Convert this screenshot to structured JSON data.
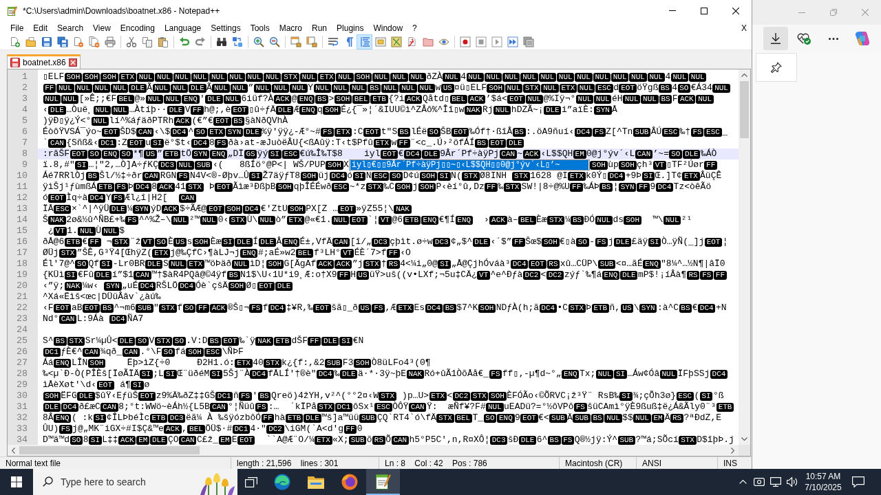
{
  "window": {
    "title": "*C:\\Users\\admin\\Downloads\\boatnet.x86 - Notepad++"
  },
  "menu": {
    "items": [
      "File",
      "Edit",
      "Search",
      "View",
      "Encoding",
      "Language",
      "Settings",
      "Tools",
      "Macro",
      "Run",
      "Plugins",
      "Window",
      "?"
    ],
    "close_document": "X"
  },
  "toolbar": {
    "toggles": [
      {
        "on": false
      },
      {
        "on": false
      },
      {
        "on": true
      }
    ]
  },
  "tabs": [
    {
      "label": "boatnet.x86",
      "selected": true,
      "modified": true
    }
  ],
  "editor": {
    "lines": [
      {
        "number": "1",
        "current": false,
        "runs": [
          "▯ELF",
          {
            "ctrl": "SOH"
          },
          {
            "ctrl": "SOH"
          },
          {
            "ctrl": "SOH"
          },
          {
            "ctrl": "ETX"
          },
          {
            "ctrl": "NUL"
          },
          {
            "ctrl": "NUL"
          },
          {
            "ctrl": "NUL"
          },
          {
            "ctrl": "NUL"
          },
          {
            "ctrl": "NUL"
          },
          {
            "ctrl": "NUL"
          },
          {
            "ctrl": "NUL"
          },
          {
            "ctrl": "NUL"
          },
          {
            "ctrl": "STX"
          },
          {
            "ctrl": "NUL"
          },
          {
            "ctrl": "ETX"
          },
          {
            "ctrl": "NUL"
          },
          {
            "ctrl": "SOH"
          },
          {
            "ctrl": "NUL"
          },
          {
            "ctrl": "NUL"
          },
          {
            "ctrl": "NUL"
          },
          "ðZÀ",
          {
            "ctrl": "NUL"
          },
          "4",
          {
            "ctrl": "NUL"
          },
          {
            "ctrl": "NUL"
          },
          {
            "ctrl": "NUL"
          },
          {
            "ctrl": "NUL"
          },
          {
            "ctrl": "NUL"
          },
          {
            "ctrl": "NUL"
          },
          {
            "ctrl": "NUL"
          },
          {
            "ctrl": "NUL"
          },
          {
            "ctrl": "NUL"
          },
          {
            "ctrl": "NUL"
          },
          {
            "ctrl": "NUL"
          },
          "4",
          {
            "ctrl": "NUL"
          },
          {
            "ctrl": "NUL"
          }
        ]
      },
      {
        "number": "2",
        "current": false,
        "runs": [
          {
            "ctrl": "FF"
          },
          {
            "ctrl": "NUL"
          },
          {
            "ctrl": "NUL"
          },
          {
            "ctrl": "NUL"
          },
          {
            "ctrl": "NUL"
          },
          {
            "ctrl": "DLE"
          },
          "Ã",
          {
            "ctrl": "NUL"
          },
          {
            "ctrl": "NUL"
          },
          {
            "ctrl": "DLE"
          },
          "Ã",
          {
            "ctrl": "NUL"
          },
          {
            "ctrl": "NUL"
          },
          "”",
          {
            "ctrl": "NUL"
          },
          {
            "ctrl": "NUL"
          },
          {
            "ctrl": "NUL"
          },
          "Y",
          {
            "ctrl": "NUL"
          },
          {
            "ctrl": "NUL"
          },
          {
            "ctrl": "NUL"
          },
          {
            "ctrl": "BS"
          },
          {
            "ctrl": "NUL"
          },
          {
            "ctrl": "NUL"
          },
          {
            "ctrl": "NUL"
          },
          "w",
          {
            "ctrl": "US"
          },
          "¤ü▯ELF",
          {
            "ctrl": "SOH"
          },
          {
            "ctrl": "NUL"
          },
          {
            "ctrl": "STX"
          },
          {
            "ctrl": "NUL"
          },
          {
            "ctrl": "ETX"
          },
          {
            "ctrl": "NUL"
          },
          {
            "ctrl": "ESC"
          },
          "d",
          {
            "ctrl": "EOT"
          },
          "öŸgß",
          {
            "ctrl": "BS"
          },
          "4",
          {
            "ctrl": "SO"
          },
          "€Á34",
          {
            "ctrl": "NUL"
          }
        ]
      },
      {
        "number": "3",
        "current": false,
        "runs": [
          {
            "ctrl": "NUL"
          },
          {
            "ctrl": "NUL"
          },
          "[»Ê;;€F",
          {
            "ctrl": "BEL"
          },
          "@»",
          {
            "ctrl": "NUL"
          },
          {
            "ctrl": "NUL"
          },
          {
            "ctrl": "ENQ"
          },
          "'",
          {
            "ctrl": "DLE"
          },
          {
            "ctrl": "NUL"
          },
          "6iüf?À",
          {
            "ctrl": "ACK"
          },
          "@",
          {
            "ctrl": "ENQ"
          },
          {
            "ctrl": "BS"
          },
          ">",
          {
            "ctrl": "SOH"
          },
          {
            "ctrl": "BEL"
          },
          {
            "ctrl": "ETB"
          },
          "{?i",
          {
            "ctrl": "ACK"
          },
          "Qåtd▯",
          {
            "ctrl": "BEL"
          },
          {
            "ctrl": "ACK"
          },
          "’$á<",
          {
            "ctrl": "EOT"
          },
          {
            "ctrl": "NUL"
          },
          "@%Iÿ¬°",
          {
            "ctrl": "NUL"
          },
          {
            "ctrl": "NUL"
          },
          "éH",
          {
            "ctrl": "NUL"
          },
          {
            "ctrl": "NUL"
          },
          {
            "ctrl": "BS"
          },
          "F",
          {
            "ctrl": "ACK"
          },
          {
            "ctrl": "NUL"
          }
        ]
      },
      {
        "number": "4",
        "current": false,
        "runs": [
          "‹",
          {
            "ctrl": "DLE"
          },
          "…Òuë¸",
          {
            "ctrl": "NUL"
          },
          {
            "ctrl": "NUL"
          },
          "…Àtíþ··",
          {
            "ctrl": "DLE"
          },
          "V",
          {
            "ctrl": "FF"
          },
          "h@;,è",
          {
            "ctrl": "EOT"
          },
          "▯û÷ƒÄ",
          {
            "ctrl": "DLE"
          },
          "Æ",
          {
            "ctrl": "ENQ"
          },
          "q",
          {
            "ctrl": "SOH"
          },
          "É¿{¯»¦´&IUU©ì^ZÂô%^Îî▯w",
          {
            "ctrl": "NAK"
          },
          "Rj",
          {
            "ctrl": "NUL"
          },
          "hDZÃ~¡",
          {
            "ctrl": "DLE"
          },
          "i”aïÈ:",
          {
            "ctrl": "SYN"
          },
          "Å"
        ]
      },
      {
        "number": "5",
        "current": false,
        "runs": [
          ")ÿÐ▯ÿ¿Ý<°",
          {
            "ctrl": "NUL"
          },
          "lí^%áƒäðPTRh",
          {
            "ctrl": "ACK"
          },
          "(€”€",
          {
            "ctrl": "EOT"
          },
          {
            "ctrl": "BS"
          },
          "§àNðQVhÀ"
        ]
      },
      {
        "number": "6",
        "current": false,
        "runs": [
          "ÉòôŸVSÁ¯ýo~",
          {
            "ctrl": "EOT"
          },
          "ŠD$",
          {
            "ctrl": "CAN"
          },
          "‹\\$",
          {
            "ctrl": "DC4"
          },
          "^",
          {
            "ctrl": "SO"
          },
          {
            "ctrl": "ETX"
          },
          {
            "ctrl": "SYN"
          },
          {
            "ctrl": "DLE"
          },
          "%ÿ'ÿÿ¿-Æ°~#",
          {
            "ctrl": "FS"
          },
          {
            "ctrl": "ETX"
          },
          ":C",
          {
            "ctrl": "EOT"
          },
          "t\"S",
          {
            "ctrl": "BS"
          },
          "lÉë",
          {
            "ctrl": "SO"
          },
          "ŠB",
          {
            "ctrl": "EOT"
          },
          "‰Óf†·ßîÂ",
          {
            "ctrl": "BS"
          },
          ":.öA9ñuí‹",
          {
            "ctrl": "DC4"
          },
          {
            "ctrl": "FS"
          },
          "Z[^Tn",
          {
            "ctrl": "SUB"
          },
          "ÂÚ",
          {
            "ctrl": "ESC"
          },
          "‰†",
          {
            "ctrl": "FS"
          },
          {
            "ctrl": "ESC"
          },
          "_"
        ]
      },
      {
        "number": "7",
        "current": false,
        "runs": [
          "`",
          {
            "ctrl": "CAN"
          },
          "{Sñß&‹",
          {
            "ctrl": "DC1"
          },
          ":Z",
          {
            "ctrl": "EOT"
          },
          "u",
          {
            "ctrl": "SI"
          },
          "ë°$t‹",
          {
            "ctrl": "DC4"
          },
          "8",
          {
            "ctrl": "FS"
          },
          "ðà›at-æJuòëÂU{<ßAûÿ:T‹t$Pfû",
          {
            "ctrl": "ETX"
          },
          "w",
          {
            "ctrl": "FF"
          },
          "¨<c_.Ú›²öfÁÍ",
          {
            "ctrl": "BS"
          },
          {
            "ctrl": "EOT"
          },
          {
            "ctrl": "DLE"
          }
        ]
      },
      {
        "number": "8",
        "current": true,
        "runs": [
          ":râŠF",
          {
            "ctrl": "EOT"
          },
          {
            "ctrl": "SO"
          },
          {
            "ctrl": "ENQ"
          },
          {
            "ctrl": "SO"
          },
          "*¶",
          {
            "ctrl": "US"
          },
          "”",
          {
            "ctrl": "ETB"
          },
          "tÖ",
          {
            "ctrl": "SYN"
          },
          {
            "ctrl": "ENQ"
          },
          "„DÏ",
          {
            "ctrl": "GS"
          },
          "ÿý",
          {
            "ctrl": "SI"
          },
          {
            "ctrl": "ESC"
          },
          "€ú‰Î‰T$8    iyl",
          {
            "ctrl": "EOT"
          },
          "€",
          {
            "ctrl": "DC4"
          },
          {
            "ctrl": "DLE"
          },
          "9Âr´Pf÷àÿPj",
          {
            "ctrl": "CAN"
          },
          "~",
          {
            "ctrl": "ACK"
          },
          "‹L$$QH",
          {
            "ctrl": "EM"
          },
          "0@j°ýv´‹L",
          {
            "ctrl": "CAN"
          },
          "’~=",
          {
            "ctrl": "SO"
          },
          {
            "ctrl": "DLE"
          },
          "‰ÁÒ"
        ]
      },
      {
        "number": "9",
        "current": false,
        "runs": [
          "ï.8,#\"",
          {
            "ctrl": "SI"
          },
          "…¦\"2,…Ò]A÷ƒKÇ",
          {
            "ctrl": "DC3"
          },
          {
            "ctrl": "NUL"
          },
          {
            "ctrl": "SUB"
          },
          "‹(   8ßÍö°@P<| WŠ/PUP",
          {
            "ctrl": "SOH"
          },
          "X"
        ],
        "autocomplete": {
          "items": [
            {
              "text": "iyl▯€▯▯9Âr´Pf÷àÿPj▯▯~▯‹L$$QH▯▯0@j°ýv´‹L▯’~",
              "selected": true
            }
          ]
        },
        "runs_after": [
          {
            "ctrl": "SOH"
          },
          "ùp",
          {
            "ctrl": "SOH"
          },
          "çh³",
          {
            "ctrl": "VT"
          },
          "▯TF²Úør",
          {
            "ctrl": "FF"
          }
        ]
      },
      {
        "number": "10",
        "current": false,
        "runs": [
          "Áé7RRlÒj",
          {
            "ctrl": "BS"
          },
          "Šl/½‡÷ðr",
          {
            "ctrl": "CAN"
          },
          "RGN",
          {
            "ctrl": "FS"
          },
          "N4V<®-Øþv…Û",
          {
            "ctrl": "SI"
          },
          "Ž7äÿƒT8",
          {
            "ctrl": "SOH"
          },
          "üj",
          {
            "ctrl": "DC4"
          },
          "ó",
          {
            "ctrl": "SI"
          },
          "N",
          {
            "ctrl": "ESC"
          },
          {
            "ctrl": "SO"
          },
          "D¢ú",
          {
            "ctrl": "SOH"
          },
          {
            "ctrl": "SI"
          },
          "N(",
          {
            "ctrl": "STX"
          },
          "Ø8INH ",
          {
            "ctrl": "STX"
          },
          "1628 @I",
          {
            "ctrl": "ETX"
          },
          "k0Ý▯",
          {
            "ctrl": "DC4"
          },
          "+9Þ",
          {
            "ctrl": "SI"
          },
          "Œ.]T¢",
          {
            "ctrl": "ETX"
          },
          "ÂüÇÊ"
        ]
      },
      {
        "number": "11",
        "current": false,
        "runs": [
          "ÿìŠj¹ƒùmßÁ",
          {
            "ctrl": "ETB"
          },
          {
            "ctrl": "FS"
          },
          "Þ",
          {
            "ctrl": "DC4"
          },
          "8",
          {
            "ctrl": "ACK"
          },
          "41",
          {
            "ctrl": "STX"
          },
          " Þ",
          {
            "ctrl": "EOT"
          },
          "Ãìæ³ÐßþB",
          {
            "ctrl": "SOH"
          },
          "qþÎÉÉwð",
          {
            "ctrl": "ESC"
          },
          "~*z",
          {
            "ctrl": "STX"
          },
          "‰C",
          {
            "ctrl": "SOH"
          },
          "j",
          {
            "ctrl": "SOH"
          },
          "P‹èí°û,Dz",
          {
            "ctrl": "FF"
          },
          "‰",
          {
            "ctrl": "STX"
          },
          "SW!|8÷@%U",
          {
            "ctrl": "FF"
          },
          "‰ÁÞ",
          {
            "ctrl": "BS"
          },
          "¦",
          {
            "ctrl": "SYN"
          },
          {
            "ctrl": "FF"
          },
          "9",
          {
            "ctrl": "DC4"
          },
          "Tz<òêÃö"
        ]
      },
      {
        "number": "12",
        "current": false,
        "runs": [
          "ó",
          {
            "ctrl": "EOT"
          },
          "Ìq÷à",
          {
            "ctrl": "DC4"
          },
          "Y",
          {
            "ctrl": "FS"
          },
          "Æl¿î|H2[  ",
          {
            "ctrl": "CAN"
          }
        ]
      },
      {
        "number": "13",
        "current": false,
        "runs": [
          "ÏÅ",
          {
            "ctrl": "ESC"
          },
          "×`^|^ÿÜ",
          {
            "ctrl": "DLE"
          },
          "¼",
          {
            "ctrl": "SYN"
          },
          "ýD",
          {
            "ctrl": "ACK"
          },
          "$÷ÃÆ@",
          {
            "ctrl": "EOT"
          },
          {
            "ctrl": "SOH"
          },
          {
            "ctrl": "DC4"
          },
          "€'ZtU",
          {
            "ctrl": "SOH"
          },
          "PX[Z …",
          {
            "ctrl": "EOT"
          },
          "»ÿZ55¦\\",
          {
            "ctrl": "NAK"
          }
        ]
      },
      {
        "number": "14",
        "current": false,
        "runs": [
          "Š",
          {
            "ctrl": "NAK"
          },
          "2ø&½û^ÑB£+‰",
          {
            "ctrl": "FS"
          },
          "^^%Ž–\\",
          {
            "ctrl": "NUL"
          },
          "²™",
          {
            "ctrl": "NUL"
          },
          "0‹",
          {
            "ctrl": "STX"
          },
          "Ù\\",
          {
            "ctrl": "NUL"
          },
          "ò”",
          {
            "ctrl": "ETX"
          },
          "@«€1.",
          {
            "ctrl": "NUL"
          },
          {
            "ctrl": "EOT"
          },
          "`¦",
          {
            "ctrl": "VT"
          },
          "@6",
          {
            "ctrl": "ETB"
          },
          {
            "ctrl": "ENQ"
          },
          "€¶Í",
          {
            "ctrl": "ENQ"
          },
          "  ›",
          {
            "ctrl": "ACK"
          },
          "à–",
          {
            "ctrl": "BEL"
          },
          "Èæ",
          {
            "ctrl": "STX"
          },
          "¼",
          {
            "ctrl": "BS"
          },
          "ÐÓ",
          {
            "ctrl": "NUL"
          },
          "ds",
          {
            "ctrl": "SOH"
          },
          "  ™\\",
          {
            "ctrl": "NUL"
          },
          "²¹"
        ]
      },
      {
        "number": "15",
        "current": false,
        "runs": [
          " ¿",
          {
            "ctrl": "VT"
          },
          "1.",
          {
            "ctrl": "NUL"
          },
          "Ù",
          {
            "ctrl": "NUL"
          },
          "$"
        ]
      },
      {
        "number": "16",
        "current": false,
        "runs": [
          "ðÅ@6",
          {
            "ctrl": "ETB"
          },
          "€",
          {
            "ctrl": "FF"
          },
          " ¬",
          {
            "ctrl": "STX"
          },
          "¨ž",
          {
            "ctrl": "VT"
          },
          {
            "ctrl": "SO"
          },
          "È",
          {
            "ctrl": "US"
          },
          "s",
          {
            "ctrl": "SOH"
          },
          "Èæ",
          {
            "ctrl": "SI"
          },
          {
            "ctrl": "DLE"
          },
          "Í",
          {
            "ctrl": "DLE"
          },
          "Â",
          {
            "ctrl": "ENQ"
          },
          "É±‚VfÄ",
          {
            "ctrl": "CAN"
          },
          "[î/„",
          {
            "ctrl": "DC3"
          },
          "çþìt.ø÷w",
          {
            "ctrl": "DC3"
          },
          "¢„$^",
          {
            "ctrl": "DLE"
          },
          "‹´$”",
          {
            "ctrl": "FF"
          },
          "Šœ$",
          {
            "ctrl": "SOH"
          },
          "€▯à",
          {
            "ctrl": "SO"
          },
          "-",
          {
            "ctrl": "FS"
          },
          "j",
          {
            "ctrl": "DLE"
          },
          "£äÿ",
          {
            "ctrl": "SI"
          },
          "Ò…ÿÑ(_]j",
          {
            "ctrl": "EOT"
          },
          "¦"
        ]
      },
      {
        "number": "17",
        "current": false,
        "runs": [
          "ØÜj",
          {
            "ctrl": "STX"
          },
          "”ŠÊ,G³Ÿ4[ŒhÿZ(",
          {
            "ctrl": "ETX"
          },
          "j@‰ÇfC›¶àLJ¬j",
          {
            "ctrl": "ENQ"
          },
          "#;aÉ»w2",
          {
            "ctrl": "BEL"
          },
          "f³LH°",
          {
            "ctrl": "VT"
          },
          "ÉÈ´7>f",
          {
            "ctrl": "FF"
          },
          "‹O"
        ]
      },
      {
        "number": "18",
        "current": false,
        "runs": [
          "Él'7@^",
          {
            "ctrl": "SO"
          },
          "Qf",
          {
            "ctrl": "SI"
          },
          "-Lr0BR",
          {
            "ctrl": "DLE"
          },
          "S",
          {
            "ctrl": "NUL"
          },
          {
            "ctrl": "ETX"
          },
          "™öÞäð",
          {
            "ctrl": "NUL"
          },
          "ìD¦",
          {
            "ctrl": "SOH"
          },
          "G[ÄgAf",
          {
            "ctrl": "ACK"
          },
          {
            "ctrl": "ACK"
          },
          "”j",
          {
            "ctrl": "STX"
          },
          "†",
          {
            "ctrl": "RS"
          },
          "4<¼i„0@",
          {
            "ctrl": "SI"
          },
          "„Å@ÇjhÓváà³",
          {
            "ctrl": "DC4"
          },
          {
            "ctrl": "EOT"
          },
          {
            "ctrl": "RS"
          },
          "xû…CÜP\\",
          {
            "ctrl": "SUB"
          },
          "<¤…ãÉ",
          {
            "ctrl": "ENQ"
          },
          "\"8¼^…½N¶|âÏ0"
        ]
      },
      {
        "number": "19",
        "current": false,
        "runs": [
          "{KÜì",
          {
            "ctrl": "SI"
          },
          "€Fû",
          {
            "ctrl": "DLE"
          },
          "í”$1",
          {
            "ctrl": "CAN"
          },
          "™†$àR4PQâ@©4ÿf",
          {
            "ctrl": "BS"
          },
          "N1$\\U‹1U*i9¸Æ:o†X9",
          {
            "ctrl": "FF"
          },
          "H",
          {
            "ctrl": "US"
          },
          "üŸ>uš((v•LXf;¬5u‡CÄ¿",
          {
            "ctrl": "VT"
          },
          "^e^Ðƒà",
          {
            "ctrl": "DC2"
          },
          "<",
          {
            "ctrl": "DC2"
          },
          "zýƒ`‰¶á",
          {
            "ctrl": "ENQ"
          },
          {
            "ctrl": "DLE"
          },
          "mP$!¡íÂà¶",
          {
            "ctrl": "RS"
          },
          {
            "ctrl": "FS"
          },
          {
            "ctrl": "FF"
          }
        ]
      },
      {
        "number": "20",
        "current": false,
        "runs": [
          "‹”ÿ;",
          {
            "ctrl": "NAK"
          },
          "¼w‹ ",
          {
            "ctrl": "SYN"
          },
          "„uÉ",
          {
            "ctrl": "DC4"
          },
          "RŠLÖ",
          {
            "ctrl": "DC4"
          },
          "Óè`çšÄ",
          {
            "ctrl": "SOH"
          },
          "Ø▯",
          {
            "ctrl": "EOT"
          },
          {
            "ctrl": "DLE"
          }
        ]
      },
      {
        "number": "21",
        "current": false,
        "runs": [
          "^Xá«Ëìš<œc|DÜüÂâv`¿àú‰"
        ]
      },
      {
        "number": "22",
        "current": false,
        "runs": [
          "‹F",
          {
            "ctrl": "EOT"
          },
          "aB",
          {
            "ctrl": "EOT"
          },
          {
            "ctrl": "BS"
          },
          "^¬m6",
          {
            "ctrl": "SUB"
          },
          "\"",
          {
            "ctrl": "STX"
          },
          "f",
          {
            "ctrl": "SO"
          },
          {
            "ctrl": "FF"
          },
          {
            "ctrl": "ACK"
          },
          "®Š▯¬",
          {
            "ctrl": "FS"
          },
          "f",
          {
            "ctrl": "DC4"
          },
          "‡¥R,‰",
          {
            "ctrl": "EOT"
          },
          "šã▯_ð",
          {
            "ctrl": "US"
          },
          {
            "ctrl": "FS"
          },
          ",Æ",
          {
            "ctrl": "ETX"
          },
          "Es",
          {
            "ctrl": "DC4"
          },
          {
            "ctrl": "BS"
          },
          "$7^K",
          {
            "ctrl": "SOH"
          },
          "NDƒÀ(h;ã",
          {
            "ctrl": "DC4"
          },
          "•C",
          {
            "ctrl": "STX"
          },
          "Þ",
          {
            "ctrl": "ETB"
          },
          "ñ,",
          {
            "ctrl": "US"
          },
          "\\",
          {
            "ctrl": "SYN"
          },
          ":à^C",
          {
            "ctrl": "BS"
          },
          "€",
          {
            "ctrl": "DC4"
          },
          "+N"
        ]
      },
      {
        "number": "23",
        "current": false,
        "runs": [
          "Nd°",
          {
            "ctrl": "CAN"
          },
          "L:9Áà ",
          {
            "ctrl": "DC4"
          },
          "ÑA7"
        ]
      },
      {
        "number": "24",
        "current": false
      },
      {
        "number": "25",
        "current": false,
        "runs": [
          "S^",
          {
            "ctrl": "BS"
          },
          {
            "ctrl": "STX"
          },
          "Sr¼µÛ<",
          {
            "ctrl": "DLE"
          },
          {
            "ctrl": "SO"
          },
          "V",
          {
            "ctrl": "STX"
          },
          {
            "ctrl": "SO"
          },
          ".V:D",
          {
            "ctrl": "BS"
          },
          {
            "ctrl": "EOT"
          },
          "‰`ÿ",
          {
            "ctrl": "NAK"
          },
          {
            "ctrl": "ETB"
          },
          "dŠF",
          {
            "ctrl": "FF"
          },
          {
            "ctrl": "DLE"
          },
          {
            "ctrl": "SI"
          },
          "€N"
        ]
      },
      {
        "number": "26",
        "current": false,
        "runs": [
          {
            "ctrl": "DC1"
          },
          "ƒÈ€^",
          {
            "ctrl": "CAN"
          },
          "¾qð_",
          {
            "ctrl": "CAN"
          },
          ".°\\F",
          {
            "ctrl": "SO"
          },
          "fá",
          {
            "ctrl": "SOH"
          },
          {
            "ctrl": "ESC"
          },
          "\\ÑÞF"
        ]
      },
      {
        "number": "27",
        "current": false,
        "runs": [
          "Áá",
          {
            "ctrl": "ENQ"
          },
          "LÎN",
          {
            "ctrl": "SOH"
          },
          "    Ëþ>ìZ{÷0     Ð2H1.ó:",
          {
            "ctrl": "ETX"
          },
          "40",
          {
            "ctrl": "STX"
          },
          "k¿{f:,&2",
          {
            "ctrl": "SUB"
          },
          "F3",
          {
            "ctrl": "SOH"
          },
          "Ò8üLFo4³(0¶"
        ]
      },
      {
        "number": "28",
        "current": false,
        "runs": [
          "‰<µ`Ð-Ò(PÎÈš[ÏøÃÏÄ",
          {
            "ctrl": "SI"
          },
          ";L",
          {
            "ctrl": "SI"
          },
          "Œ¨üðéM",
          {
            "ctrl": "SI"
          },
          "5Šj¨À",
          {
            "ctrl": "DC4"
          },
          "fÅLÍ'†®è\"",
          {
            "ctrl": "DC4"
          },
          "‰",
          {
            "ctrl": "DLE"
          },
          "ä·*·3ÿ~þE",
          {
            "ctrl": "NAK"
          },
          "Ró+ûÃ1ÒõÅå€_",
          {
            "ctrl": "FS"
          },
          "ff▯‚-µ¶d~°„",
          {
            "ctrl": "ENQ"
          },
          "Tx;",
          {
            "ctrl": "NUL"
          },
          {
            "ctrl": "SI"
          },
          "…Áw¢Óâ",
          {
            "ctrl": "NUL"
          },
          "ÏFþSSj",
          {
            "ctrl": "DC4"
          }
        ]
      },
      {
        "number": "29",
        "current": false,
        "runs": [
          "ìÅèXøt'\\d‹",
          {
            "ctrl": "EOT"
          },
          " á¶",
          {
            "ctrl": "SI"
          },
          "ø"
        ]
      },
      {
        "number": "30",
        "current": false,
        "runs": [
          {
            "ctrl": "SOH"
          },
          "ËFG",
          {
            "ctrl": "DLE"
          },
          "$ûŸ‹EƒüŠ",
          {
            "ctrl": "EOT"
          },
          "z9%Ä‰ðZ‡‡GŠ",
          {
            "ctrl": "DC1"
          },
          "ñ",
          {
            "ctrl": "FS"
          },
          "'",
          {
            "ctrl": "BS"
          },
          "Qreö)4žYH,v²^(°°2¤‹W",
          {
            "ctrl": "STX"
          },
          " )p…U>",
          {
            "ctrl": "ETX"
          },
          "<",
          {
            "ctrl": "DC2"
          },
          {
            "ctrl": "STX"
          },
          {
            "ctrl": "SOH"
          },
          "ÈFÓÃo‹©ÕRVC¡ž³Ÿ¨ RsB‰",
          {
            "ctrl": "SI"
          },
          "¾;çÕh3ø}",
          {
            "ctrl": "ESC"
          },
          "(",
          {
            "ctrl": "SI"
          },
          "°ß"
        ]
      },
      {
        "number": "31",
        "current": false,
        "runs": [
          {
            "ctrl": "DLE"
          },
          {
            "ctrl": "DC4"
          },
          "ð£æC",
          {
            "ctrl": "CAN"
          },
          "8;°t:WWö~èÁh½{L5B",
          {
            "ctrl": "CAN"
          },
          "°¦Ñüû",
          {
            "ctrl": "FS"
          },
          ":…  ´kÏPå",
          {
            "ctrl": "STX"
          },
          {
            "ctrl": "DC1"
          },
          "ôSx¹",
          {
            "ctrl": "ESC"
          },
          "ÒÔŸ",
          {
            "ctrl": "CAN"
          },
          "Ÿ:  æÑf¥?F#",
          {
            "ctrl": "NUL"
          },
          "uEADü?=°½ôVPô",
          {
            "ctrl": "FS"
          },
          "šüCAmì°ÿÈ9ßuß‡ë¿Á&Ãly0¨³",
          {
            "ctrl": "ETB"
          }
        ]
      },
      {
        "number": "32",
        "current": false,
        "runs": [
          "8Â",
          {
            "ctrl": "ENQ"
          },
          "( :k",
          {
            "ctrl": "SI"
          },
          "¢ÎLÞbéÌc",
          {
            "ctrl": "ETB"
          },
          {
            "ctrl": "DC3"
          },
          "ëã¼ À ‰šÿózbôÓ",
          {
            "ctrl": "FF"
          },
          "hà",
          {
            "ctrl": "ETB"
          },
          {
            "ctrl": "DLE"
          },
          "™š]a™üü",
          {
            "ctrl": "SUB"
          },
          "ÇQ`RT4`ó\\fÄ",
          {
            "ctrl": "STX"
          },
          {
            "ctrl": "BEL"
          },
          "T_",
          {
            "ctrl": "SO"
          },
          {
            "ctrl": "ENQ"
          },
          "9",
          {
            "ctrl": "EOT"
          },
          "€<",
          {
            "ctrl": "SUB"
          },
          "Ä",
          {
            "ctrl": "SUB"
          },
          {
            "ctrl": "BS"
          },
          {
            "ctrl": "NUL"
          },
          "$$",
          {
            "ctrl": "NUL"
          },
          {
            "ctrl": "EM"
          },
          "Ä",
          {
            "ctrl": "RS"
          },
          "?ªÐdZ,E"
        ]
      },
      {
        "number": "33",
        "current": false,
        "runs": [
          "ÛU)",
          {
            "ctrl": "FS"
          },
          "j@„MK¨iGX÷#I$Ç&™e",
          {
            "ctrl": "ACK"
          },
          ",",
          {
            "ctrl": "BEL"
          },
          "ÖÜ$·#",
          {
            "ctrl": "DC1"
          },
          "4·\"",
          {
            "ctrl": "DC2"
          },
          "\\iGM(`A<d'g",
          {
            "ctrl": "FF"
          },
          "0"
        ]
      },
      {
        "number": "34",
        "current": false,
        "runs": [
          "D™ä™d",
          {
            "ctrl": "SO"
          },
          "8",
          {
            "ctrl": "SI"
          },
          "L‡‡",
          {
            "ctrl": "ACK"
          },
          {
            "ctrl": "EM"
          },
          {
            "ctrl": "DLE"
          },
          "ÇO",
          {
            "ctrl": "CAN"
          },
          "C£ž_",
          {
            "ctrl": "EM"
          },
          "E",
          {
            "ctrl": "EOT"
          },
          "  ``A@Æ¨O/¼",
          {
            "ctrl": "ETX"
          },
          "«X;",
          {
            "ctrl": "SUB"
          },
          "õ",
          {
            "ctrl": "RS"
          },
          "Õ",
          {
            "ctrl": "CAN"
          },
          "h5°P5C',n,R¤XÔ¦",
          {
            "ctrl": "DC3"
          },
          "šÐ",
          {
            "ctrl": "DLE"
          },
          "6^",
          {
            "ctrl": "BS"
          },
          {
            "ctrl": "FS"
          },
          "Q®½jÿ:Ý^",
          {
            "ctrl": "SUB"
          },
          "?™á;SÕcí",
          {
            "ctrl": "STX"
          },
          "D$îþÞ.j"
        ]
      }
    ]
  },
  "status_bar": [
    "Normal text file",
    "length : 21,596    lines : 301",
    "Ln : 8    Col : 42    Pos : 786",
    "Macintosh (CR)",
    "ANSI",
    "INS"
  ],
  "browser": {
    "downloads_open": true
  },
  "taskbar": {
    "search": {
      "placeholder": "Type here to search"
    },
    "apps": [
      {
        "selected": false
      },
      {
        "selected": false
      },
      {
        "selected": false
      },
      {
        "selected": true
      }
    ],
    "clock": {
      "time": "10:57 AM",
      "date": "7/10/2025"
    }
  }
}
